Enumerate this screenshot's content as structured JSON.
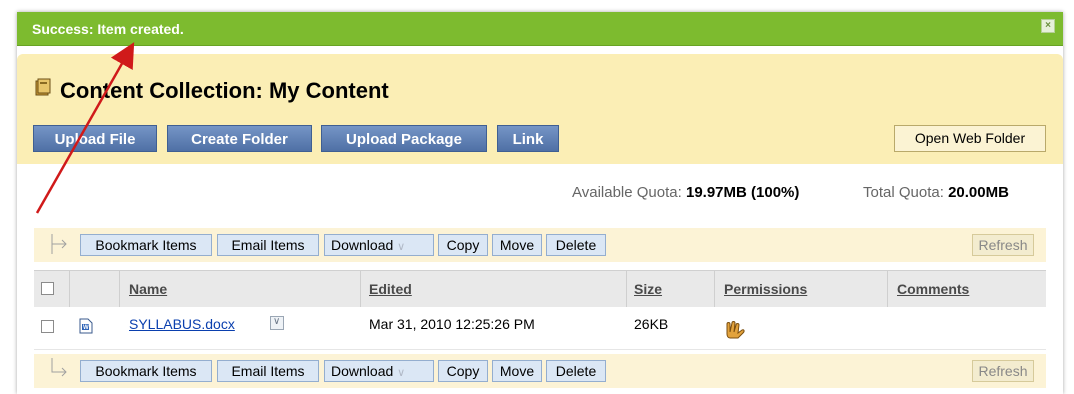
{
  "notification": {
    "message": "Success: Item created.",
    "close_label": "×"
  },
  "header": {
    "title": "Content Collection: My Content"
  },
  "actions": {
    "upload_file": "Upload File",
    "create_folder": "Create Folder",
    "upload_package": "Upload Package",
    "link": "Link",
    "open_web_folder": "Open Web Folder"
  },
  "quota": {
    "available_label": "Available Quota:",
    "available_value": "19.97MB (100%)",
    "total_label": "Total Quota:",
    "total_value": "20.00MB"
  },
  "toolbar": {
    "bookmark": "Bookmark Items",
    "email": "Email Items",
    "download": "Download",
    "copy": "Copy",
    "move": "Move",
    "delete": "Delete",
    "refresh": "Refresh"
  },
  "table": {
    "columns": [
      "Name",
      "Edited",
      "Size",
      "Permissions",
      "Comments"
    ],
    "rows": [
      {
        "name": "SYLLABUS.docx",
        "edited": "Mar 31, 2010 12:25:26 PM",
        "size": "26KB",
        "comments": ""
      }
    ]
  },
  "colors": {
    "success": "#7dbb2f",
    "header_bg": "#fbeeb5",
    "button_blue": "#5a7bb0",
    "annotation_arrow": "#d01a1a"
  }
}
